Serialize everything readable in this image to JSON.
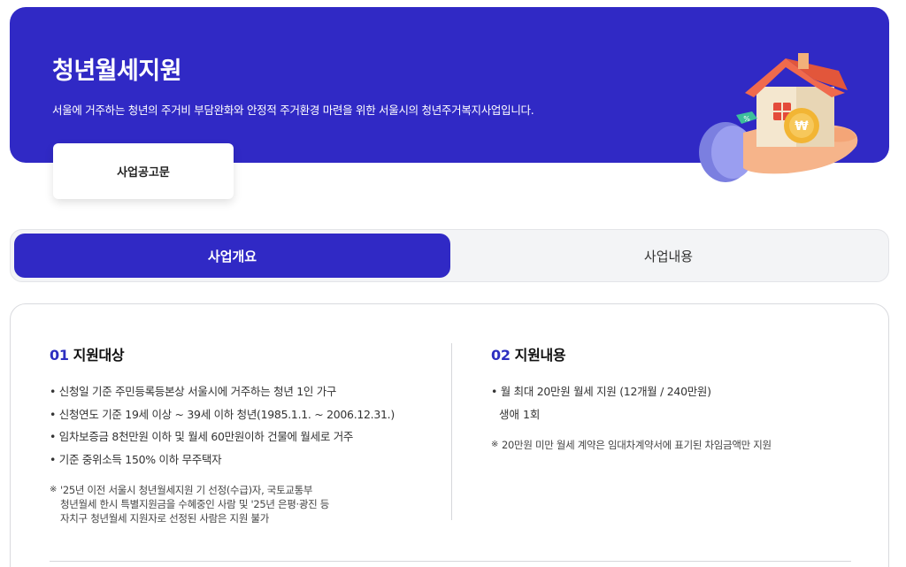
{
  "hero": {
    "title": "청년월세지원",
    "description": "서울에 거주하는 청년의 주거비 부담완화와 안정적 주거환경 마련을 위한 서울시의 청년주거복지사업입니다.",
    "notice_button": "사업공고문",
    "bg_color": "#3029c5",
    "illustration": "house-on-hand-icon"
  },
  "tabs": [
    {
      "label": "사업개요",
      "active": true
    },
    {
      "label": "사업내용",
      "active": false
    }
  ],
  "sections": {
    "target": {
      "num": "01",
      "title": "지원대상",
      "items": [
        "신청일 기준 주민등록등본상 서울시에 거주하는 청년 1인 가구",
        "신청연도 기준 19세 이상 ~ 39세 이하 청년(1985.1.1. ~ 2006.12.31.)",
        "임차보증금 8천만원 이하 및 월세 60만원이하 건물에 월세로 거주",
        "기준 중위소득 150% 이하 무주택자"
      ],
      "note_mark": "※",
      "note_lines": [
        "'25년 이전 서울시 청년월세지원 기 선정(수급)자, 국토교통부",
        "청년월세 한시 특별지원금을 수혜중인 사람 및 '25년 은평·광진 등",
        "자치구 청년월세 지원자로 선정된 사람은 지원 불가"
      ]
    },
    "content": {
      "num": "02",
      "title": "지원내용",
      "item_line1": "월 최대 20만원 월세 지원 (12개월 / 240만원)",
      "item_line2": "생애 1회",
      "note_mark": "※",
      "note": "20만원 미만 월세 계약은 임대차계약서에 표기된 차임금액만 지원"
    }
  }
}
